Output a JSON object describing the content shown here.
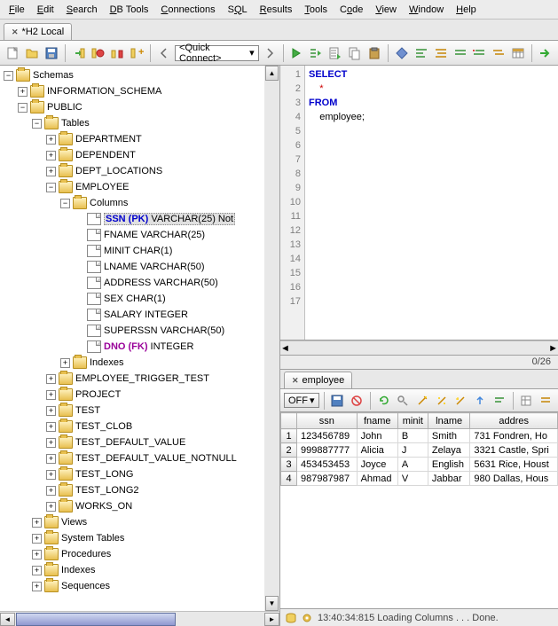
{
  "menu": [
    "File",
    "Edit",
    "Search",
    "DB Tools",
    "Connections",
    "SQL",
    "Results",
    "Tools",
    "Code",
    "View",
    "Window",
    "Help"
  ],
  "tab": {
    "label": "*H2 Local"
  },
  "quick_connect": "<Quick Connect>",
  "tree": {
    "root": "Schemas",
    "info_schema": "INFORMATION_SCHEMA",
    "public": "PUBLIC",
    "tables": "Tables",
    "table_list": [
      "DEPARTMENT",
      "DEPENDENT",
      "DEPT_LOCATIONS",
      "EMPLOYEE"
    ],
    "columns_label": "Columns",
    "columns": [
      {
        "name": "SSN (PK)",
        "type": "VARCHAR(25) Not",
        "kind": "pk"
      },
      {
        "name": "FNAME",
        "type": "VARCHAR(25)",
        "kind": ""
      },
      {
        "name": "MINIT",
        "type": "CHAR(1)",
        "kind": ""
      },
      {
        "name": "LNAME",
        "type": "VARCHAR(50)",
        "kind": ""
      },
      {
        "name": "ADDRESS",
        "type": "VARCHAR(50)",
        "kind": ""
      },
      {
        "name": "SEX",
        "type": "CHAR(1)",
        "kind": ""
      },
      {
        "name": "SALARY",
        "type": "INTEGER",
        "kind": ""
      },
      {
        "name": "SUPERSSN",
        "type": "VARCHAR(50)",
        "kind": ""
      },
      {
        "name": "DNO (FK)",
        "type": "INTEGER",
        "kind": "fk"
      }
    ],
    "indexes": "Indexes",
    "tables_rest": [
      "EMPLOYEE_TRIGGER_TEST",
      "PROJECT",
      "TEST",
      "TEST_CLOB",
      "TEST_DEFAULT_VALUE",
      "TEST_DEFAULT_VALUE_NOTNULL",
      "TEST_LONG",
      "TEST_LONG2",
      "WORKS_ON"
    ],
    "sections": [
      "Views",
      "System Tables",
      "Procedures",
      "Indexes",
      "Sequences"
    ]
  },
  "sql": {
    "lines": [
      "SELECT",
      "    *",
      "FROM",
      "    employee;",
      "",
      "",
      "",
      "",
      "",
      "",
      "",
      "",
      "",
      "",
      "",
      "",
      ""
    ],
    "counter": "0/26"
  },
  "result": {
    "tab": "employee",
    "off": "OFF",
    "headers": [
      "ssn",
      "fname",
      "minit",
      "lname",
      "addres"
    ],
    "rows": [
      [
        "123456789",
        "John",
        "B",
        "Smith",
        "731 Fondren, Ho"
      ],
      [
        "999887777",
        "Alicia",
        "J",
        "Zelaya",
        "3321 Castle, Spri"
      ],
      [
        "453453453",
        "Joyce",
        "A",
        "English",
        "5631 Rice, Houst"
      ],
      [
        "987987987",
        "Ahmad",
        "V",
        "Jabbar",
        "980 Dallas, Hous"
      ]
    ]
  },
  "status": "13:40:34:815 Loading Columns . . . Done."
}
